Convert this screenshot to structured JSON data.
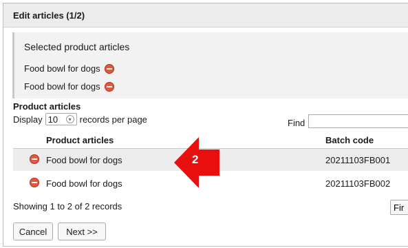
{
  "dialog": {
    "title": "Edit articles (1/2)"
  },
  "selected": {
    "heading": "Selected product articles",
    "items": [
      {
        "label": "Food bowl for dogs",
        "icon": "remove-icon"
      },
      {
        "label": "Food bowl for dogs",
        "icon": "remove-icon"
      }
    ]
  },
  "articles": {
    "section_title": "Product articles",
    "display_label": "Display",
    "per_page": "10",
    "per_page_suffix": "records per page",
    "find_label": "Find",
    "find_value": "",
    "columns": [
      "Product articles",
      "Batch code"
    ],
    "rows": [
      {
        "name": "Food bowl for dogs",
        "batch": "20211103FB001",
        "icon": "remove-icon"
      },
      {
        "name": "Food bowl for dogs",
        "batch": "20211103FB002",
        "icon": "remove-icon"
      }
    ],
    "showing": "Showing 1 to 2 of 2 records",
    "find_button": "Fir"
  },
  "annotation": {
    "label": "2",
    "color": "#e8100f"
  },
  "buttons": {
    "cancel": "Cancel",
    "next": "Next >>"
  },
  "colors": {
    "remove_icon": "#e2573e",
    "highlight_row": "#ececec",
    "titlebar": "#ececec"
  }
}
